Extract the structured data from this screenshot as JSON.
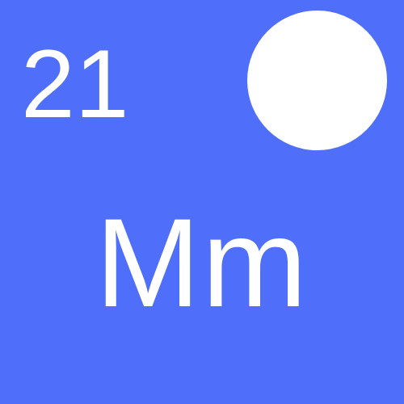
{
  "tile": {
    "atomic_number": "21",
    "symbol": "Mm",
    "background_color": "#4f6ffb",
    "foreground_color": "#ffffff",
    "marker_shape": "circle"
  }
}
